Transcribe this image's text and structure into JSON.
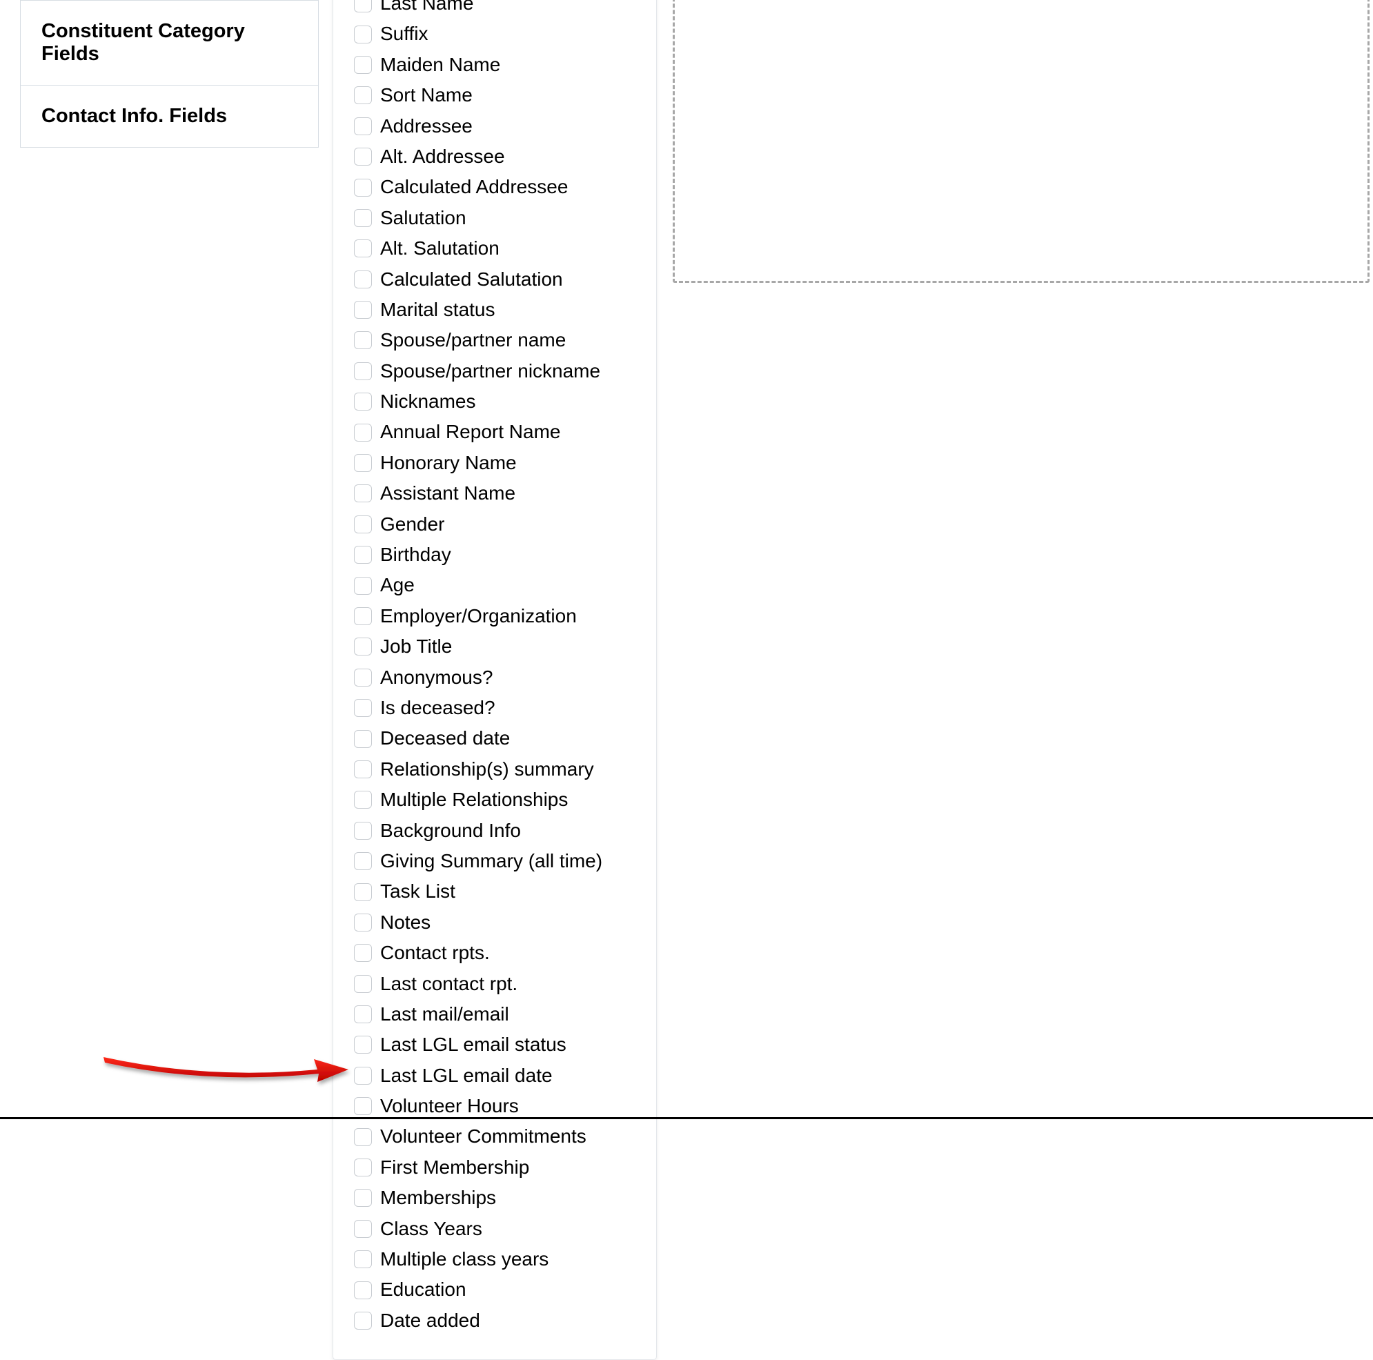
{
  "sidebar": {
    "headers": [
      "Constituent Category Fields",
      "Contact Info. Fields"
    ]
  },
  "fields": [
    "Last Name",
    "Suffix",
    "Maiden Name",
    "Sort Name",
    "Addressee",
    "Alt. Addressee",
    "Calculated Addressee",
    "Salutation",
    "Alt. Salutation",
    "Calculated Salutation",
    "Marital status",
    "Spouse/partner name",
    "Spouse/partner nickname",
    "Nicknames",
    "Annual Report Name",
    "Honorary Name",
    "Assistant Name",
    "Gender",
    "Birthday",
    "Age",
    "Employer/Organization",
    "Job Title",
    "Anonymous?",
    "Is deceased?",
    "Deceased date",
    "Relationship(s) summary",
    "Multiple Relationships",
    "Background Info",
    "Giving Summary (all time)",
    "Task List",
    "Notes",
    "Contact rpts.",
    "Last contact rpt.",
    "Last mail/email",
    "Last LGL email status",
    "Last LGL email date",
    "Volunteer Hours",
    "Volunteer Commitments",
    "First Membership",
    "Memberships",
    "Class Years",
    "Multiple class years",
    "Education",
    "Date added"
  ]
}
